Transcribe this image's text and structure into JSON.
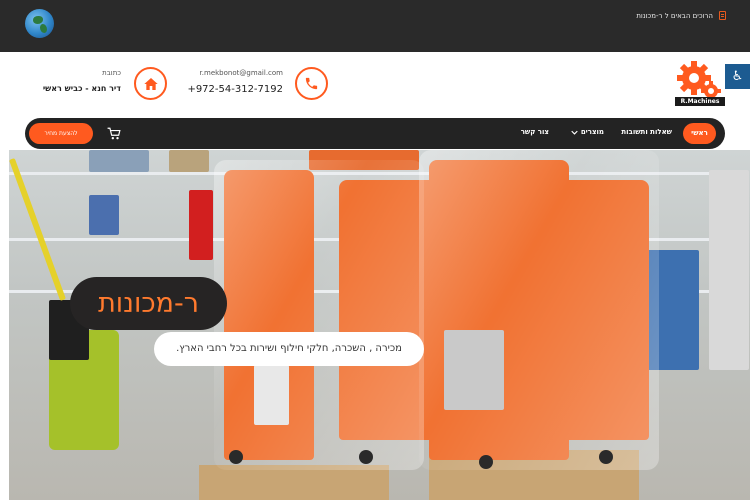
{
  "topbar": {
    "notice": "הרוכים הבאים ל ר-מכונות",
    "globe_icon": "globe-icon",
    "doc_icon": "document-icon"
  },
  "brand": {
    "logo_text": "R.Machines",
    "accent": "#ff5a1f",
    "dark": "#232323"
  },
  "accessibility": {
    "icon": "accessibility-icon",
    "symbol": "♿"
  },
  "contact": {
    "email": "r.mekbonot@gmail.com",
    "phone": "+972-54-312-7192",
    "address_label": "כתובת",
    "address": "דיר חנא - כביש ראשי"
  },
  "nav": {
    "home": "ראשי",
    "items": [
      "שאלות ותשובות",
      "מוצרים",
      "צור קשר"
    ],
    "cta": "להצעת מחיר",
    "cart_icon": "cart-icon"
  },
  "hero": {
    "title": "ר-מכונות",
    "subtitle": "מכירה , השכרה, חלקי חילוף ושירות בכל רחבי הארץ."
  }
}
